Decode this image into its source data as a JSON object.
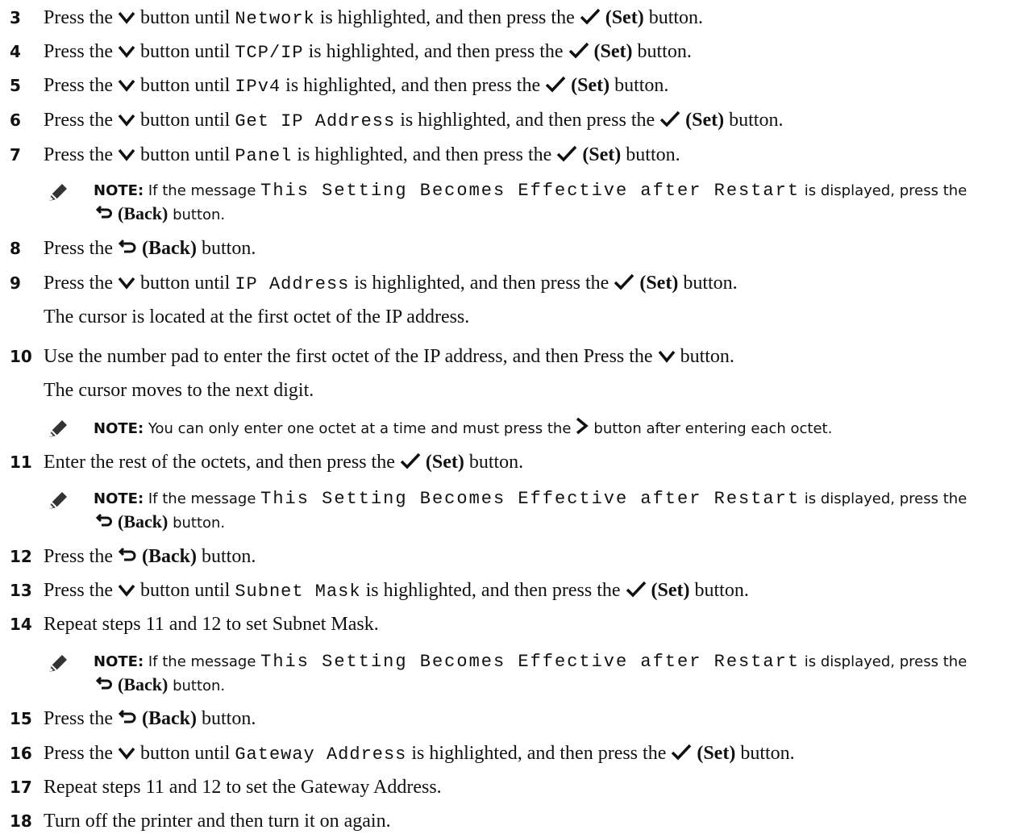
{
  "steps": [
    {
      "num": "3",
      "a": "Press the",
      "b": "button until",
      "code": "Network",
      "c": "is highlighted, and then press the",
      "d": "(Set)",
      "e": "button."
    },
    {
      "num": "4",
      "a": "Press the",
      "b": "button until",
      "code": "TCP/IP",
      "c": "is highlighted, and then press the",
      "d": "(Set)",
      "e": "button."
    },
    {
      "num": "5",
      "a": "Press the",
      "b": "button until",
      "code": "IPv4",
      "c": "is highlighted, and then press the",
      "d": "(Set)",
      "e": "button."
    },
    {
      "num": "6",
      "a": "Press the",
      "b": "button until",
      "code": "Get IP Address",
      "c": "is highlighted, and then press the",
      "d": "(Set)",
      "e": "button."
    },
    {
      "num": "7",
      "a": "Press the",
      "b": "button until",
      "code": "Panel",
      "c": "is highlighted, and then press the",
      "d": "(Set)",
      "e": "button."
    },
    {
      "num": "8",
      "a": "Press the",
      "d": "(Back)",
      "e": "button."
    },
    {
      "num": "9",
      "a": "Press the",
      "b": "button until",
      "code": "IP Address",
      "c": "is highlighted, and then press the",
      "d": "(Set)",
      "e": "button."
    },
    {
      "sub": "The cursor is located at the first octet of the IP address."
    },
    {
      "num": "10",
      "a": "Use the number pad to enter the first octet of the IP address, and then Press the",
      "e": "button."
    },
    {
      "sub": "The cursor moves to the next digit."
    },
    {
      "num": "11",
      "a": "Enter the rest of the octets, and then press the",
      "d": "(Set)",
      "e": "button."
    },
    {
      "num": "12",
      "a": "Press the",
      "d": "(Back)",
      "e": "button."
    },
    {
      "num": "13",
      "a": "Press the",
      "b": "button until",
      "code": "Subnet Mask",
      "c": "is highlighted, and then press the",
      "d": "(Set)",
      "e": "button."
    },
    {
      "num": "14",
      "a": "Repeat steps 11 and 12 to set Subnet Mask."
    },
    {
      "num": "15",
      "a": "Press the",
      "d": "(Back)",
      "e": "button."
    },
    {
      "num": "16",
      "a": "Press the",
      "b": "button until",
      "code": "Gateway Address",
      "c": "is highlighted, and then press the",
      "d": "(Set)",
      "e": "button."
    },
    {
      "num": "17",
      "a": "Repeat steps 11 and 12 to set the Gateway Address."
    },
    {
      "num": "18",
      "a": "Turn off the printer and then turn it on again."
    }
  ],
  "notes": {
    "restart": {
      "label": "NOTE:",
      "pre": "If the message",
      "code": "This Setting Becomes Effective after Restart",
      "post": "is displayed, press the",
      "back": "(Back)",
      "button": "button."
    },
    "octet": {
      "label": "NOTE:",
      "pre": "You can only enter one octet at a time and must press the",
      "post": "button after entering each octet."
    }
  }
}
